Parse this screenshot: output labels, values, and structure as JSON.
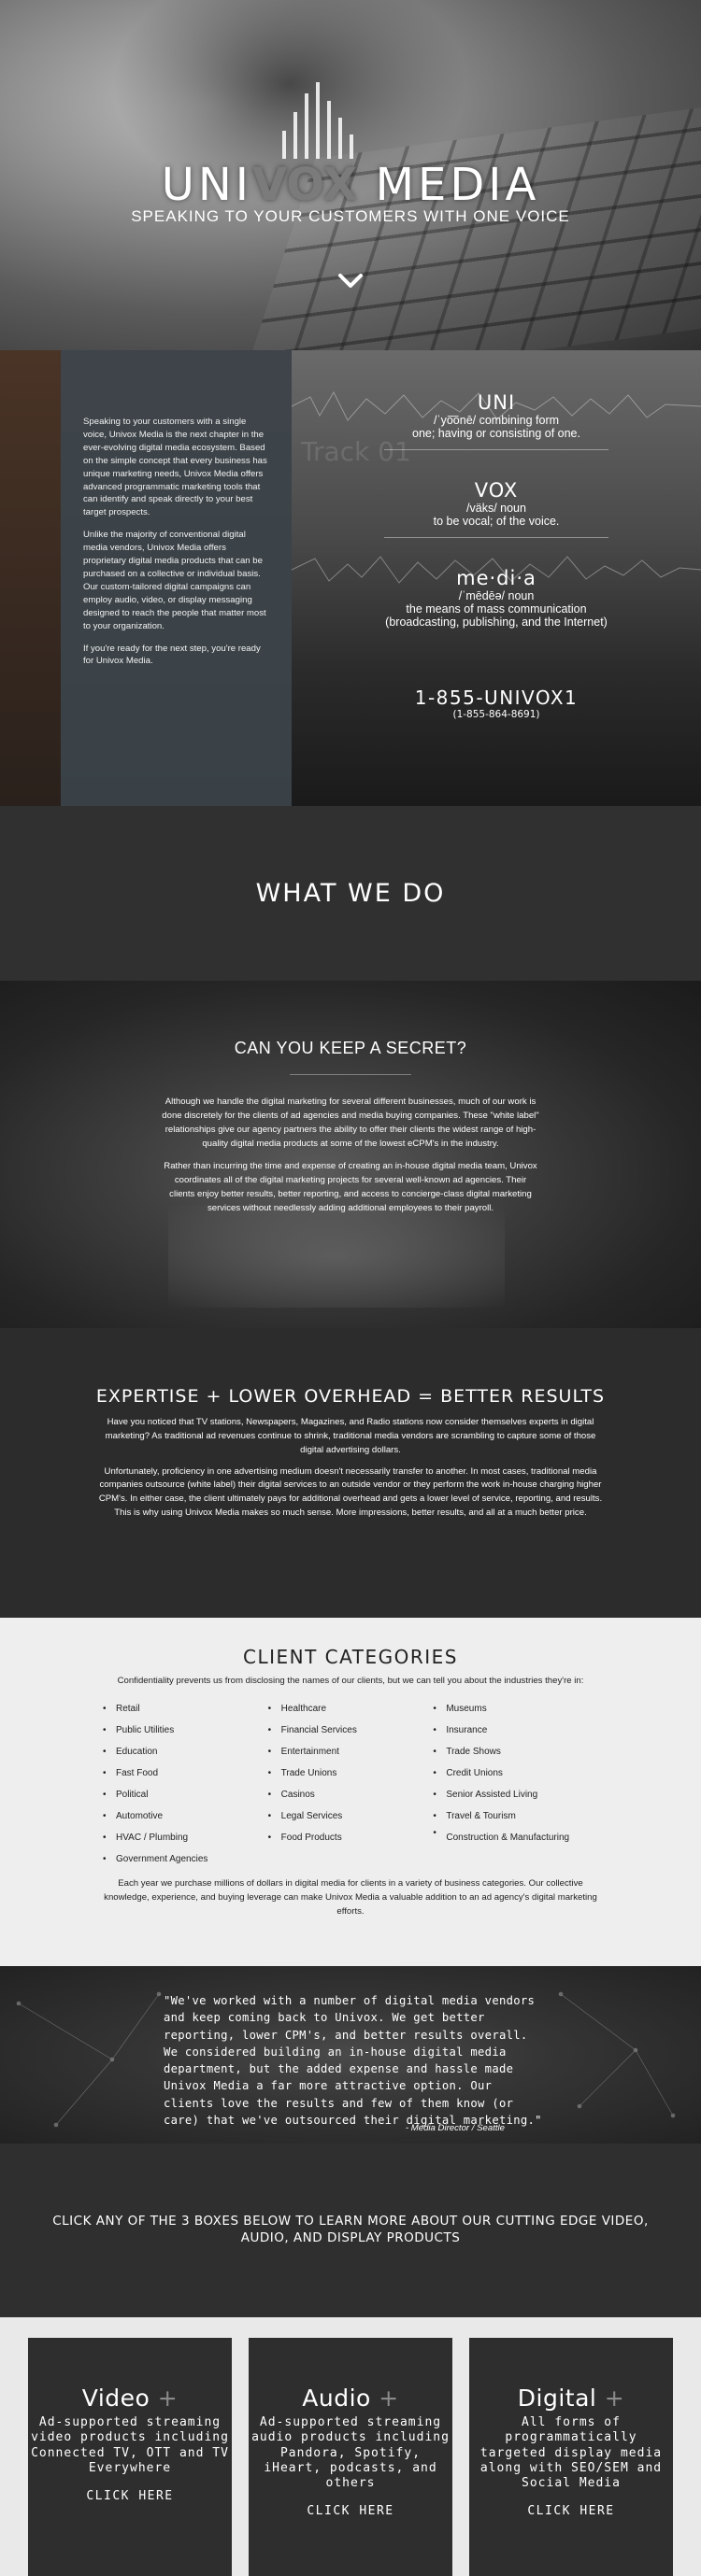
{
  "hero": {
    "brand_part1": "UNI",
    "brand_vox": "VOX",
    "brand_part2": "MEDIA",
    "tagline": "SPEAKING TO YOUR CUSTOMERS WITH ONE VOICE"
  },
  "intro": {
    "paragraphs": [
      "Speaking to your customers with a single voice, Univox Media is the next chapter in the ever-evolving digital media ecosystem. Based on the simple concept that every business has unique marketing needs, Univox Media offers advanced programmatic marketing tools that can identify and speak directly to your best target prospects.",
      "Unlike the majority of conventional digital media vendors, Univox Media offers proprietary digital media products that can be purchased on a collective or individual basis. Our custom-tailored digital campaigns can employ audio, video, or display messaging designed to reach the people that matter most to your organization.",
      "If you're ready for the next step, you're ready for Univox Media."
    ],
    "definitions": [
      {
        "word": "UNI",
        "pron": "/ˈyo͞onē/ combining form",
        "meaning": "one; having or consisting of one."
      },
      {
        "word": "VOX",
        "pron": "/väks/ noun",
        "meaning": "to be vocal; of the voice."
      },
      {
        "word": "me·di·a",
        "pron": "/ˈmēdēə/ noun",
        "meaning": "the means of mass communication",
        "meaning2": "(broadcasting, publishing, and the Internet)"
      }
    ],
    "phone_vanity": "1-855-UNIVOX1",
    "phone_numeric": "(1-855-864-8691)",
    "bg_text": "Track 01"
  },
  "what_we_do": {
    "title": "WHAT WE DO"
  },
  "secret": {
    "title": "CAN YOU KEEP A SECRET?",
    "paragraphs": [
      "Although we handle the digital marketing for several different businesses, much of our work is done discretely for the clients of ad agencies and media buying companies. These \"white label\" relationships give our agency partners the ability to offer their clients the widest range of high-quality digital media products at some of the lowest eCPM's in the industry.",
      "Rather than incurring the time and expense of creating an in-house digital media team, Univox coordinates all of the digital marketing projects for several well-known ad agencies. Their clients enjoy better results, better reporting, and access to concierge-class digital marketing services without needlessly adding additional employees to their payroll."
    ]
  },
  "expertise": {
    "title": "EXPERTISE + LOWER OVERHEAD = BETTER RESULTS",
    "paragraphs": [
      "Have you noticed that TV stations, Newspapers, Magazines, and Radio stations now consider themselves experts in digital marketing? As traditional ad revenues continue to shrink, traditional media vendors are scrambling to capture some of those digital advertising dollars.",
      "Unfortunately, proficiency in one advertising medium doesn't necessarily transfer to another. In most cases, traditional media companies outsource (white label) their digital services to an outside vendor or they perform the work in-house charging higher CPM's. In either case, the client ultimately pays for additional overhead and gets a lower level of service, reporting, and results. This is why using Univox Media makes so much sense. More impressions, better results, and all at a much better price."
    ]
  },
  "clients": {
    "title": "CLIENT CATEGORIES",
    "intro": "Confidentiality prevents us from disclosing the names of our clients, but we can tell you about the industries they're in:",
    "columns": [
      [
        "Retail",
        "Public Utilities",
        "Education",
        "Fast Food",
        "Political",
        "Automotive",
        "HVAC / Plumbing",
        "Government Agencies"
      ],
      [
        "Healthcare",
        "Financial Services",
        "Entertainment",
        "Trade Unions",
        "Casinos",
        "Legal Services",
        "Food Products"
      ],
      [
        "Museums",
        "Insurance",
        "Trade Shows",
        "Credit Unions",
        "Senior Assisted Living",
        "Travel & Tourism",
        "Construction & Manufacturing"
      ]
    ],
    "outro": "Each year we purchase millions of dollars in digital media for clients in a variety of business categories. Our collective knowledge, experience, and buying leverage can make Univox Media a valuable addition to an ad agency's digital marketing efforts."
  },
  "testimonial": {
    "quote": "\"We've worked with a number of digital media vendors and keep coming back to Univox. We get better reporting, lower CPM's, and better results overall. We considered building an in-house digital media department, but the added expense and hassle made Univox Media a far more attractive option. Our clients love the results and few of them know (or care) that we've outsourced their digital marketing.\"",
    "cite": "- Media Director / Seattle"
  },
  "cta": {
    "text": "CLICK ANY OF THE 3 BOXES BELOW TO LEARN MORE ABOUT OUR CUTTING EDGE VIDEO, AUDIO, AND DISPLAY PRODUCTS"
  },
  "products": [
    {
      "title": "Video",
      "plus": "+",
      "desc": "Ad-supported streaming video products including Connected TV, OTT and TV Everywhere",
      "cta": "CLICK HERE"
    },
    {
      "title": "Audio",
      "plus": "+",
      "desc": "Ad-supported streaming audio products including Pandora, Spotify, iHeart, podcasts, and others",
      "cta": "CLICK HERE"
    },
    {
      "title": "Digital",
      "plus": "+",
      "desc": "All forms of programmatically targeted display media along with SEO/SEM and Social Media",
      "cta": "CLICK HERE"
    }
  ]
}
